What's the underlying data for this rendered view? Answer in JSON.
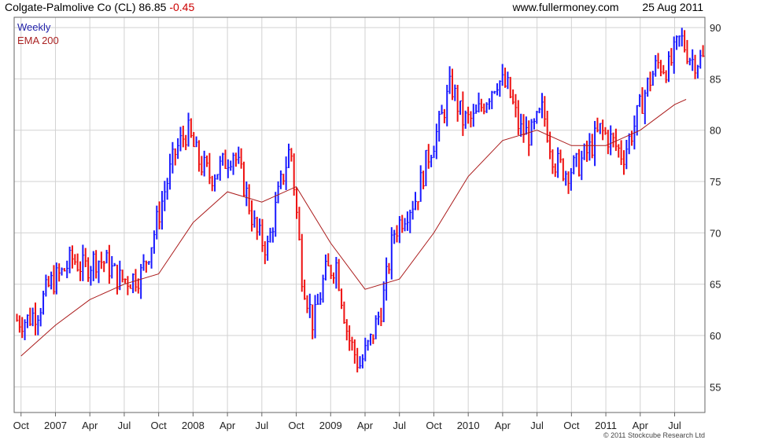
{
  "header": {
    "title": "Colgate-Palmolive Co (CL) 86.85",
    "change": "-0.45",
    "website": "www.fullermoney.com",
    "date": "25 Aug 2011"
  },
  "legend": {
    "weekly_label": "Weekly",
    "ema_label": "EMA 200"
  },
  "credit": "© 2011 Stockcube Research Ltd",
  "colors": {
    "up": "#1a1aff",
    "down": "#ee1111",
    "ema": "#aa1a1a",
    "grid": "#d2d2d2",
    "axis": "#555555"
  },
  "chart_data": {
    "type": "candlestick-weekly",
    "title": "Colgate-Palmolive Co (CL)",
    "ylim": [
      52.5,
      91
    ],
    "y_ticks": [
      55,
      60,
      65,
      70,
      75,
      80,
      85,
      90
    ],
    "x_ticks": [
      "Oct",
      "2007",
      "Apr",
      "Jul",
      "Oct",
      "2008",
      "Apr",
      "Jul",
      "Oct",
      "2009",
      "Apr",
      "Jul",
      "Oct",
      "2010",
      "Apr",
      "Jul",
      "Oct",
      "2011",
      "Apr",
      "Jul"
    ],
    "grid": true,
    "legend_position": "top-left",
    "series": [
      {
        "name": "Weekly",
        "style": "high-low bars",
        "points": [
          {
            "date": "2006-10",
            "close": 61.5
          },
          {
            "date": "2006-11",
            "close": 62.5
          },
          {
            "date": "2006-12",
            "close": 65.0
          },
          {
            "date": "2007-01",
            "close": 66.0
          },
          {
            "date": "2007-02",
            "close": 67.5
          },
          {
            "date": "2007-03",
            "close": 66.5
          },
          {
            "date": "2007-04",
            "close": 67.5
          },
          {
            "date": "2007-05",
            "close": 67.0
          },
          {
            "date": "2007-06",
            "close": 65.5
          },
          {
            "date": "2007-07",
            "close": 65.5
          },
          {
            "date": "2007-08",
            "close": 66.0
          },
          {
            "date": "2007-09",
            "close": 69.5
          },
          {
            "date": "2007-10",
            "close": 74.0
          },
          {
            "date": "2007-11",
            "close": 78.0
          },
          {
            "date": "2007-12",
            "close": 80.0
          },
          {
            "date": "2008-01",
            "close": 77.0
          },
          {
            "date": "2008-02",
            "close": 75.5
          },
          {
            "date": "2008-03",
            "close": 76.5
          },
          {
            "date": "2008-04",
            "close": 78.0
          },
          {
            "date": "2008-05",
            "close": 74.5
          },
          {
            "date": "2008-06",
            "close": 70.0
          },
          {
            "date": "2008-07",
            "close": 68.5
          },
          {
            "date": "2008-08",
            "close": 74.0
          },
          {
            "date": "2008-09",
            "close": 78.5
          },
          {
            "date": "2008-10",
            "close": 66.0
          },
          {
            "date": "2008-11",
            "close": 61.0
          },
          {
            "date": "2008-12",
            "close": 66.0
          },
          {
            "date": "2009-01",
            "close": 67.0
          },
          {
            "date": "2009-02",
            "close": 60.0
          },
          {
            "date": "2009-03",
            "close": 57.0
          },
          {
            "date": "2009-04",
            "close": 59.5
          },
          {
            "date": "2009-05",
            "close": 63.0
          },
          {
            "date": "2009-06",
            "close": 70.0
          },
          {
            "date": "2009-07",
            "close": 72.0
          },
          {
            "date": "2009-08",
            "close": 73.5
          },
          {
            "date": "2009-09",
            "close": 77.5
          },
          {
            "date": "2009-10",
            "close": 80.5
          },
          {
            "date": "2009-11",
            "close": 84.5
          },
          {
            "date": "2009-12",
            "close": 81.0
          },
          {
            "date": "2010-01",
            "close": 81.0
          },
          {
            "date": "2010-02",
            "close": 83.0
          },
          {
            "date": "2010-03",
            "close": 85.0
          },
          {
            "date": "2010-04",
            "close": 84.0
          },
          {
            "date": "2010-05",
            "close": 80.0
          },
          {
            "date": "2010-06",
            "close": 79.5
          },
          {
            "date": "2010-07",
            "close": 82.0
          },
          {
            "date": "2010-08",
            "close": 77.0
          },
          {
            "date": "2010-09",
            "close": 76.0
          },
          {
            "date": "2010-10",
            "close": 76.5
          },
          {
            "date": "2010-11",
            "close": 78.0
          },
          {
            "date": "2010-12",
            "close": 80.0
          },
          {
            "date": "2011-01",
            "close": 79.0
          },
          {
            "date": "2011-02",
            "close": 77.5
          },
          {
            "date": "2011-03",
            "close": 80.5
          },
          {
            "date": "2011-04",
            "close": 84.0
          },
          {
            "date": "2011-05",
            "close": 86.5
          },
          {
            "date": "2011-06",
            "close": 86.0
          },
          {
            "date": "2011-07",
            "close": 89.0
          },
          {
            "date": "2011-08",
            "close": 86.85
          }
        ]
      },
      {
        "name": "EMA 200",
        "style": "line",
        "points": [
          {
            "date": "2006-10",
            "value": 58.0
          },
          {
            "date": "2007-01",
            "value": 61.0
          },
          {
            "date": "2007-04",
            "value": 63.5
          },
          {
            "date": "2007-07",
            "value": 65.0
          },
          {
            "date": "2007-10",
            "value": 66.0
          },
          {
            "date": "2008-01",
            "value": 71.0
          },
          {
            "date": "2008-04",
            "value": 74.0
          },
          {
            "date": "2008-07",
            "value": 73.0
          },
          {
            "date": "2008-10",
            "value": 74.5
          },
          {
            "date": "2009-01",
            "value": 69.0
          },
          {
            "date": "2009-04",
            "value": 64.5
          },
          {
            "date": "2009-07",
            "value": 65.5
          },
          {
            "date": "2009-10",
            "value": 70.0
          },
          {
            "date": "2010-01",
            "value": 75.5
          },
          {
            "date": "2010-04",
            "value": 79.0
          },
          {
            "date": "2010-07",
            "value": 80.0
          },
          {
            "date": "2010-10",
            "value": 78.5
          },
          {
            "date": "2011-01",
            "value": 78.5
          },
          {
            "date": "2011-04",
            "value": 80.0
          },
          {
            "date": "2011-07",
            "value": 82.5
          },
          {
            "date": "2011-08",
            "value": 83.0
          }
        ]
      }
    ]
  }
}
